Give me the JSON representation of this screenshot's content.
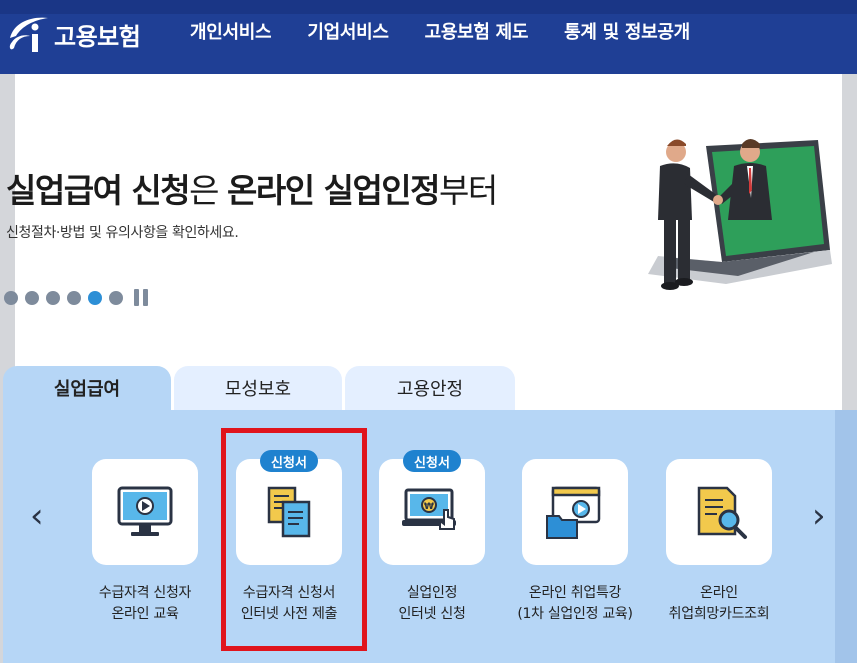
{
  "header": {
    "logo_text": "고용보험",
    "nav": [
      "개인서비스",
      "기업서비스",
      "고용보험 제도",
      "통계 및 정보공개"
    ]
  },
  "hero": {
    "title_parts": [
      {
        "text": "실업급여 신청",
        "bold": true
      },
      {
        "text": "은 ",
        "bold": false
      },
      {
        "text": "온라인 실업인정",
        "bold": true
      },
      {
        "text": "부터",
        "bold": false
      }
    ],
    "subtitle": "신청절차·방법 및 유의사항을 확인하세요.",
    "slide_count": 6,
    "active_slide": 5
  },
  "tabs": [
    {
      "label": "실업급여",
      "active": true
    },
    {
      "label": "모성보호",
      "active": false
    },
    {
      "label": "고용안정",
      "active": false
    }
  ],
  "services": [
    {
      "label": "수급자격 신청자\n온라인 교육",
      "badge": "",
      "icon": "monitor-play-icon"
    },
    {
      "label": "수급자격 신청서\n인터넷 사전 제출",
      "badge": "신청서",
      "icon": "documents-icon"
    },
    {
      "label": "실업인정\n인터넷 신청",
      "badge": "신청서",
      "icon": "laptop-click-icon"
    },
    {
      "label": "온라인 취업특강\n(1차 실업인정 교육)",
      "badge": "",
      "icon": "video-folder-icon"
    },
    {
      "label": "온라인\n취업희망카드조회",
      "badge": "",
      "icon": "card-search-icon"
    }
  ],
  "colors": {
    "header": "#1f3f95",
    "panel": "#b6d6f6",
    "badge": "#1f82cf",
    "highlight": "#e0141c",
    "dot_active": "#2d8fd6"
  }
}
